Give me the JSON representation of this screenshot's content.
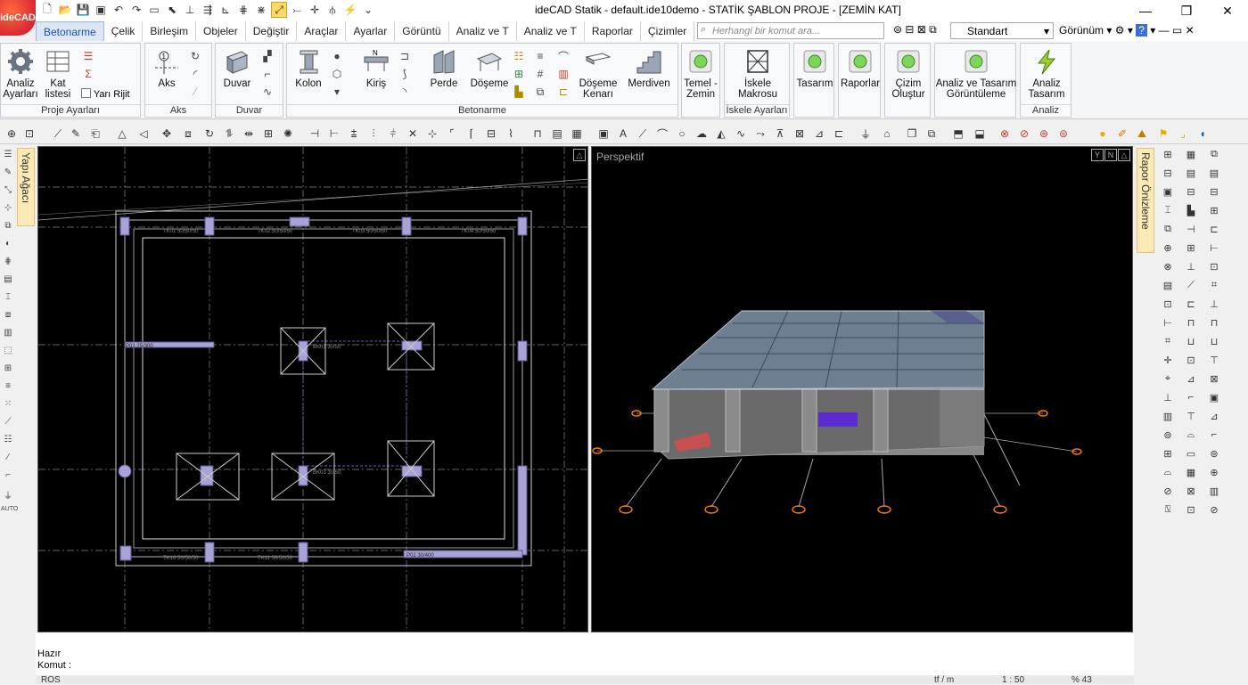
{
  "app": {
    "logo_text": "ideCAD",
    "title": "ideCAD Statik - default.ide10demo - STATİK ŞABLON PROJE - [ZEMİN KAT]",
    "window_controls": [
      "—",
      "❐",
      "✕"
    ]
  },
  "tabs": [
    "Betonarme",
    "Çelik",
    "Birleşim",
    "Objeler",
    "Değiştir",
    "Araçlar",
    "Ayarlar",
    "Görüntü",
    "Analiz ve T",
    "Analiz ve T",
    "Raporlar",
    "Çizimler"
  ],
  "search": {
    "placeholder": "Herhangi bir komut ara..."
  },
  "style_select": {
    "value": "Standart"
  },
  "view_menu": {
    "label": "Görünüm"
  },
  "ribbon": {
    "proje": {
      "label": "Proje Ayarları",
      "analiz": "Analiz\nAyarları",
      "kat": "Kat\nlistesi",
      "yari": "Yarı Rijit"
    },
    "aks": {
      "label": "Aks",
      "btn": "Aks"
    },
    "duvar": {
      "label": "Duvar",
      "btn": "Duvar"
    },
    "betonarme": {
      "label": "Betonarme",
      "kolon": "Kolon",
      "kiris": "Kiriş",
      "perde": "Perde",
      "doseme": "Döşeme",
      "doseme_kenari": "Döşeme\nKenarı",
      "merdiven": "Merdiven"
    },
    "temel": {
      "btn": "Temel -\nZemin"
    },
    "iskele": {
      "label": "İskele Ayarları",
      "btn": "İskele\nMakrosu"
    },
    "tasarim": {
      "btn": "Tasarım"
    },
    "raporlar": {
      "btn": "Raporlar"
    },
    "cizim": {
      "btn": "Çizim\nOluştur"
    },
    "analiz_gor": {
      "btn": "Analiz ve Tasarım\nGörüntüleme"
    },
    "analiz": {
      "label": "Analiz",
      "btn": "Analiz\nTasarım"
    }
  },
  "side_tabs": {
    "left": "Yapı Ağacı",
    "right": "Rapor Önizleme"
  },
  "viewports": {
    "perspective_label": "Perspektif",
    "plan_labels": [
      "TK01 50/50/50",
      "TK02 50/50/50",
      "TK03 50/50/50",
      "TK04 50/50/50",
      "P01 25/300",
      "BK01 30/50",
      "BK03 30/50",
      "TK10 50/50/50",
      "TK11 50/50/50",
      "P02 30/400"
    ]
  },
  "status": {
    "line1": "Hazır",
    "line2": "Komut :",
    "bottom_left": "ROS",
    "units": "tf / m",
    "scale": "1 : 50",
    "zoom": "% 43"
  },
  "colors": {
    "accent": "#1a56a8",
    "viewport_bg": "#000000",
    "column": "#a8a3d6",
    "orange": "#ff7a00"
  }
}
